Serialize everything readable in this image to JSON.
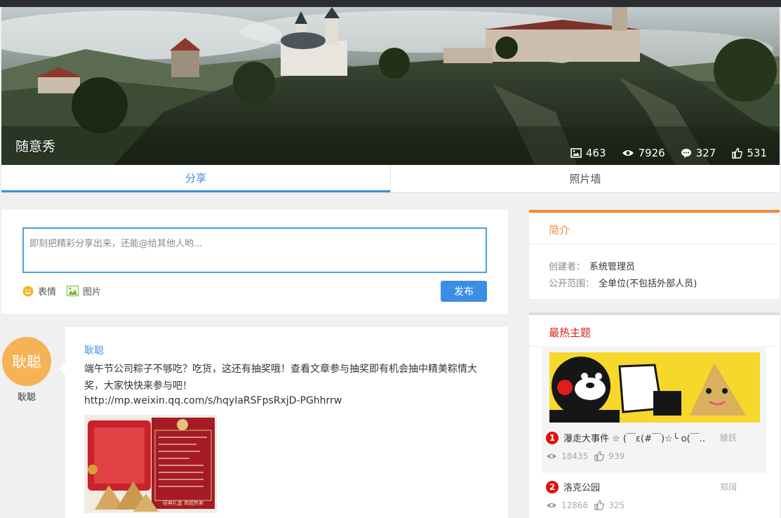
{
  "hero": {
    "title": "随意秀",
    "stats": [
      {
        "icon": "image-icon",
        "value": "463"
      },
      {
        "icon": "eye-icon",
        "value": "7926"
      },
      {
        "icon": "comment-icon",
        "value": "327"
      },
      {
        "icon": "thumbs-up-icon",
        "value": "531"
      }
    ]
  },
  "tabs": [
    {
      "label": "分享",
      "active": true
    },
    {
      "label": "照片墙",
      "active": false
    }
  ],
  "composer": {
    "placeholder": "即刻把精彩分享出来，还能@给其他人哟...",
    "emoji_label": "表情",
    "image_label": "图片",
    "publish_label": "发布"
  },
  "post": {
    "avatar_text": "耿聪",
    "avatar_name": "耿聪",
    "author": "耿聪",
    "body": "端午节公司粽子不够吃？吃货，这还有抽奖哦！查看文章参与抽奖即有机会抽中精美粽情大奖，大家快快来参与吧！",
    "link": "http://mp.weixin.qq.com/s/hqyIaRSFpsRxjD-PGhhrrw",
    "image_label": "经典礼盒 商超热卖"
  },
  "intro": {
    "title": "简介",
    "creator_key": "创建者：",
    "creator_value": "系统管理员",
    "scope_key": "公开范围：",
    "scope_value": "全单位(不包括外部人员)"
  },
  "hot": {
    "title": "最热主题",
    "items": [
      {
        "rank": "1",
        "title": "瀑走大事件 ☆ (￣ε(#￣)☆╰ o(￣..",
        "author": "滕跃",
        "views": "18435",
        "likes": "939"
      },
      {
        "rank": "2",
        "title": "洛克公园",
        "author": "郑阔",
        "views": "12866",
        "likes": "325"
      }
    ]
  },
  "colors": {
    "accent": "#3a8ee6",
    "intro_accent": "#f0883a",
    "hot_accent": "#d9251c",
    "avatar": "#f5b257"
  }
}
